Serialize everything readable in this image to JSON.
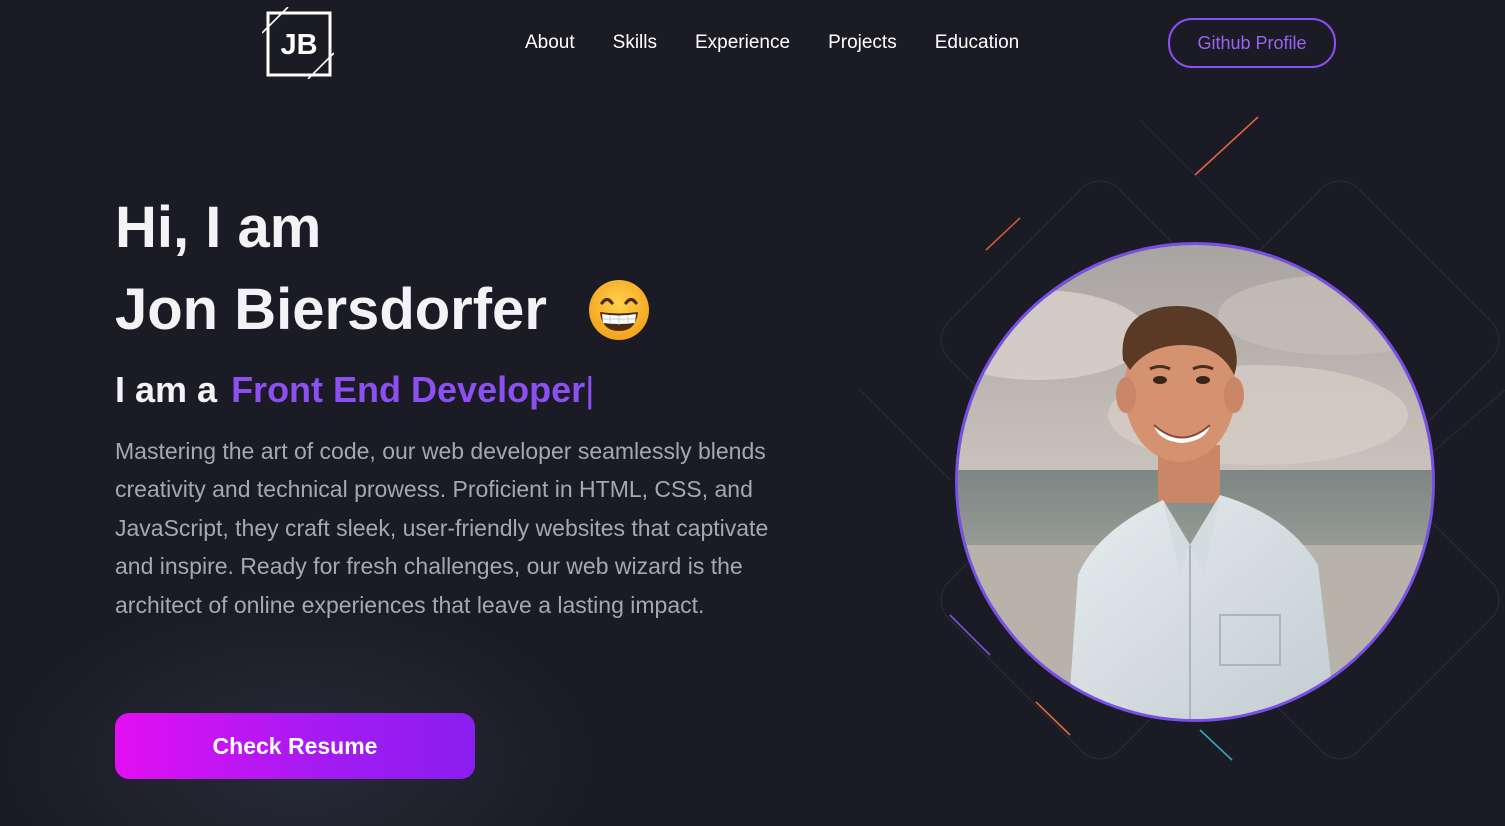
{
  "header": {
    "logo_text": "JB",
    "nav": [
      "About",
      "Skills",
      "Experience",
      "Projects",
      "Education"
    ],
    "github_label": "Github Profile"
  },
  "hero": {
    "greeting": "Hi, I am",
    "name": "Jon Biersdorfer",
    "emoji_icon": "grinning-face-icon",
    "role_prefix": "I am a",
    "role_title": "Front End Developer",
    "cursor": "|",
    "description": "Mastering the art of code, our web developer seamlessly blends creativity and technical prowess. Proficient in HTML, CSS, and JavaScript, they craft sleek, user-friendly websites that captivate and inspire. Ready for fresh challenges, our web wizard is the architect of online experiences that leave a lasting impact.",
    "resume_label": "Check Resume"
  },
  "colors": {
    "background": "#1b1b25",
    "accent": "#8d4ff2",
    "button_gradient_start": "#e20ff2",
    "button_gradient_end": "#8a1ef0"
  }
}
